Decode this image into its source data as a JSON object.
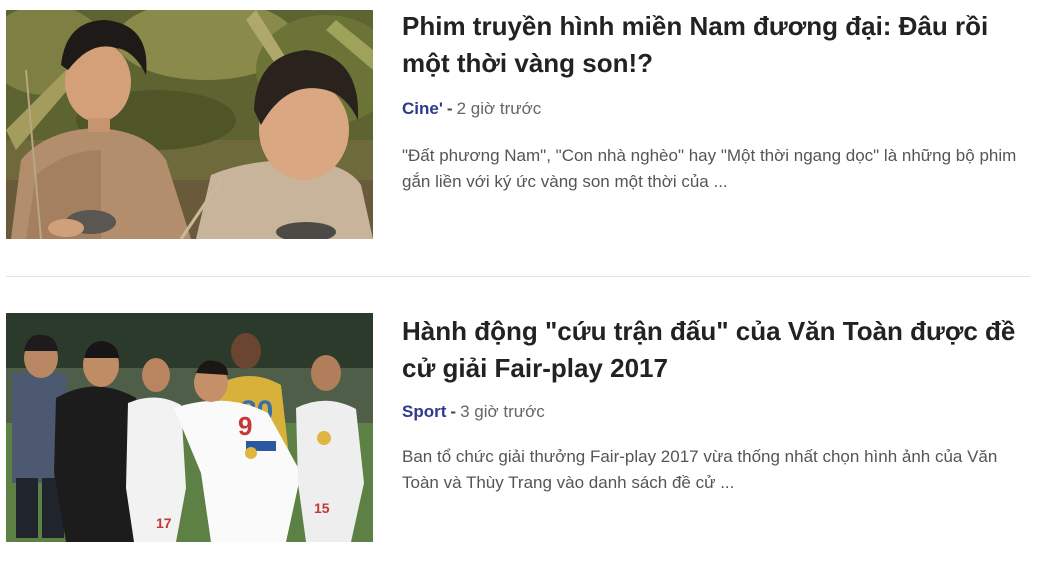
{
  "articles": [
    {
      "title": "Phim truyền hình miền Nam đương đại: Đâu rồi một thời vàng son!?",
      "category": "Cine'",
      "separator": "-",
      "time": "2 giờ trước",
      "summary": "\"Đất phương Nam\", \"Con nhà nghèo\" hay \"Một thời ngang dọc\" là những bộ phim gắn liền với ký ức vàng son một thời của ..."
    },
    {
      "title": "Hành động \"cứu trận đấu\" của Văn Toàn được đề cử giải Fair-play 2017",
      "category": "Sport",
      "separator": "-",
      "time": "3 giờ trước",
      "summary": "Ban tổ chức giải thưởng Fair-play 2017 vừa thống nhất chọn hình ảnh của Văn Toàn và Thùy Trang vào danh sách đề cử ...",
      "thumbnail_text": {
        "jersey_back_number": "20",
        "jersey_player_number": "9",
        "jersey_left_number": "17",
        "jersey_right_number": "15"
      }
    }
  ],
  "colors": {
    "title": "#222222",
    "category": "#2d3a8c",
    "meta": "#666666",
    "summary": "#555555",
    "divider": "#e3e3e3"
  }
}
